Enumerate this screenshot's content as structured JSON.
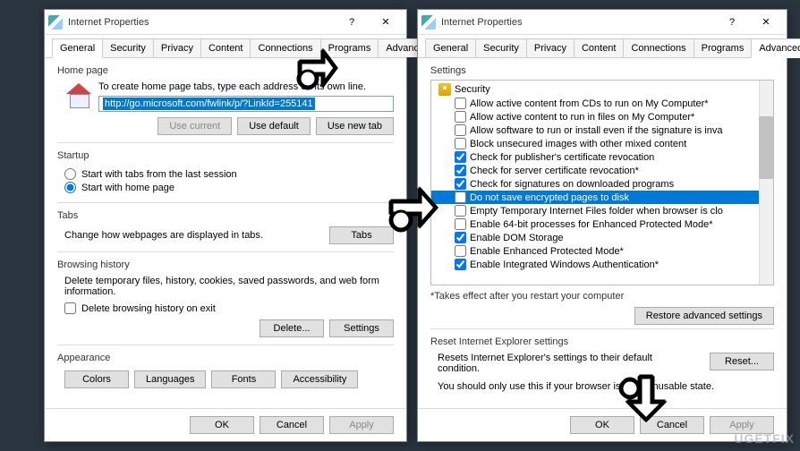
{
  "window": {
    "title": "Internet Properties",
    "help": "?",
    "close": "✕"
  },
  "tabs": {
    "general": "General",
    "security": "Security",
    "privacy": "Privacy",
    "content": "Content",
    "connections": "Connections",
    "programs": "Programs",
    "advanced": "Advanced"
  },
  "general": {
    "home_title": "Home page",
    "home_hint": "To create home page tabs, type each address on its own line.",
    "url": "http://go.microsoft.com/fwlink/p/?LinkId=255141",
    "use_current": "Use current",
    "use_default": "Use default",
    "use_new_tab": "Use new tab",
    "startup_title": "Startup",
    "startup_last": "Start with tabs from the last session",
    "startup_home": "Start with home page",
    "tabs_title": "Tabs",
    "tabs_hint": "Change how webpages are displayed in tabs.",
    "tabs_btn": "Tabs",
    "history_title": "Browsing history",
    "history_hint": "Delete temporary files, history, cookies, saved passwords, and web form information.",
    "history_exit": "Delete browsing history on exit",
    "delete": "Delete...",
    "settings": "Settings",
    "appearance_title": "Appearance",
    "colors": "Colors",
    "languages": "Languages",
    "fonts": "Fonts",
    "accessibility": "Accessibility"
  },
  "advanced": {
    "settings_title": "Settings",
    "security_node": "Security",
    "items": [
      {
        "c": false,
        "t": "Allow active content from CDs to run on My Computer*"
      },
      {
        "c": false,
        "t": "Allow active content to run in files on My Computer*"
      },
      {
        "c": false,
        "t": "Allow software to run or install even if the signature is inva"
      },
      {
        "c": false,
        "t": "Block unsecured images with other mixed content"
      },
      {
        "c": true,
        "t": "Check for publisher's certificate revocation"
      },
      {
        "c": true,
        "t": "Check for server certificate revocation*"
      },
      {
        "c": true,
        "t": "Check for signatures on downloaded programs"
      },
      {
        "c": false,
        "t": "Do not save encrypted pages to disk",
        "sel": true
      },
      {
        "c": false,
        "t": "Empty Temporary Internet Files folder when browser is clo"
      },
      {
        "c": false,
        "t": "Enable 64-bit processes for Enhanced Protected Mode*"
      },
      {
        "c": true,
        "t": "Enable DOM Storage"
      },
      {
        "c": false,
        "t": "Enable Enhanced Protected Mode*"
      },
      {
        "c": true,
        "t": "Enable Integrated Windows Authentication*"
      }
    ],
    "note": "*Takes effect after you restart your computer",
    "restore": "Restore advanced settings",
    "reset_title": "Reset Internet Explorer settings",
    "reset_hint": "Resets Internet Explorer's settings to their default condition.",
    "reset_btn": "Reset...",
    "reset_warn": "You should only use this if your browser is in an unusable state."
  },
  "footer": {
    "ok": "OK",
    "cancel": "Cancel",
    "apply": "Apply"
  },
  "watermark": "UGETFIX"
}
